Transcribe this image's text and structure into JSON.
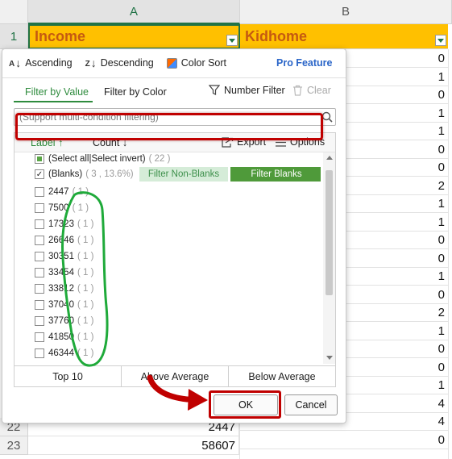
{
  "sheet": {
    "columns": [
      "A",
      "B"
    ],
    "header_row_number": "1",
    "header_a": "Income",
    "header_b": "Kidhome",
    "b_values": [
      "0",
      "1",
      "0",
      "1",
      "1",
      "0",
      "0",
      "2",
      "1",
      "1",
      "0",
      "0",
      "1",
      "0",
      "2",
      "1",
      "0",
      "0",
      "1",
      "4",
      "4",
      "0"
    ],
    "bottom_rows": [
      {
        "row": "22",
        "a": "2447"
      },
      {
        "row": "23",
        "a": "58607"
      }
    ]
  },
  "dialog": {
    "sort": {
      "ascending": "Ascending",
      "descending": "Descending",
      "color_sort": "Color Sort",
      "pro_feature": "Pro Feature"
    },
    "tabs": {
      "filter_by_value": "Filter by Value",
      "filter_by_color": "Filter by Color",
      "number_filter": "Number Filter",
      "clear": "Clear"
    },
    "search_placeholder": "(Support multi-condition filtering)",
    "list_header": {
      "label": "Label",
      "count": "Count",
      "export": "Export",
      "options": "Options"
    },
    "select_all": {
      "label": "(Select all|Select invert)",
      "count": "( 22 )"
    },
    "blanks": {
      "label": "(Blanks)",
      "count": "( 3 , 13.6%)",
      "filter_non_blanks": "Filter Non-Blanks",
      "filter_blanks": "Filter Blanks"
    },
    "values": [
      {
        "label": "2447",
        "count": "( 1 )"
      },
      {
        "label": "7500",
        "count": "( 1 )"
      },
      {
        "label": "17323",
        "count": "( 1 )"
      },
      {
        "label": "26646",
        "count": "( 1 )"
      },
      {
        "label": "30351",
        "count": "( 1 )"
      },
      {
        "label": "33454",
        "count": "( 1 )"
      },
      {
        "label": "33812",
        "count": "( 1 )"
      },
      {
        "label": "37040",
        "count": "( 1 )"
      },
      {
        "label": "37760",
        "count": "( 1 )"
      },
      {
        "label": "41850",
        "count": "( 1 )"
      },
      {
        "label": "46344",
        "count": "( 1 )"
      }
    ],
    "quick": {
      "top10": "Top 10",
      "above_average": "Above Average",
      "below_average": "Below Average"
    },
    "ok": "OK",
    "cancel": "Cancel"
  },
  "colors": {
    "header_fill": "#ffc000",
    "header_text": "#c55a11",
    "accent_green": "#2e8b3d",
    "filter_blanks_bg": "#4f9a3a",
    "pro_blue": "#2a65c8",
    "annotation_red": "#c00000",
    "annotation_green": "#1faa3a"
  }
}
